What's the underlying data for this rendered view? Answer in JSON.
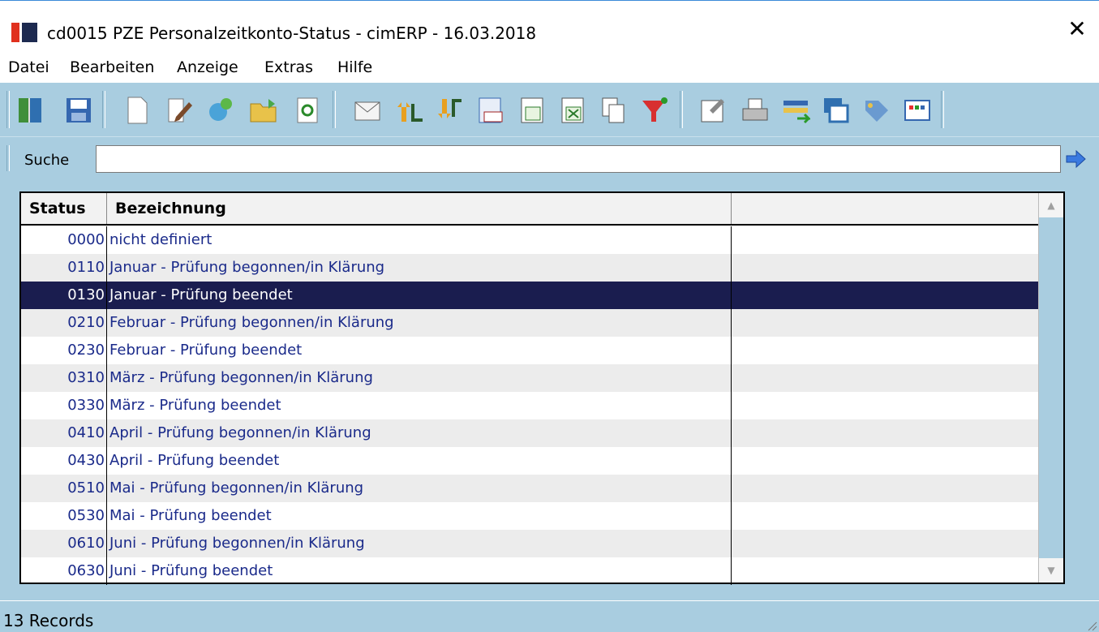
{
  "window": {
    "title": "cd0015 PZE Personalzeitkonto-Status - cimERP - 16.03.2018",
    "close_label": "✕"
  },
  "menu": [
    "Datei",
    "Bearbeiten",
    "Anzeige",
    "Extras",
    "Hilfe"
  ],
  "toolbar": {
    "buttons": [
      "exit-icon",
      "save-icon",
      "new-document-icon",
      "edit-icon",
      "copy-record-icon",
      "open-folder-icon",
      "refresh-icon",
      "mail-icon",
      "sort-ascending-icon",
      "sort-descending-icon",
      "number-format-icon",
      "export-icon",
      "excel-icon",
      "copy-icon",
      "filter-icon",
      "properties-icon",
      "print-icon",
      "transfer-icon",
      "windows-icon",
      "tag-icon",
      "grid-layout-icon"
    ]
  },
  "search": {
    "label": "Suche",
    "value": "",
    "go_icon": "arrow-right-icon"
  },
  "table": {
    "columns": [
      "Status",
      "Bezeichnung",
      ""
    ],
    "selected_index": 2,
    "rows": [
      {
        "status": "0000",
        "desc": "nicht definiert"
      },
      {
        "status": "0110",
        "desc": "Januar - Prüfung begonnen/in Klärung"
      },
      {
        "status": "0130",
        "desc": "Januar - Prüfung beendet"
      },
      {
        "status": "0210",
        "desc": "Februar - Prüfung begonnen/in Klärung"
      },
      {
        "status": "0230",
        "desc": "Februar - Prüfung beendet"
      },
      {
        "status": "0310",
        "desc": "März - Prüfung begonnen/in Klärung"
      },
      {
        "status": "0330",
        "desc": "März - Prüfung beendet"
      },
      {
        "status": "0410",
        "desc": "April - Prüfung begonnen/in Klärung"
      },
      {
        "status": "0430",
        "desc": "April - Prüfung beendet"
      },
      {
        "status": "0510",
        "desc": "Mai - Prüfung begonnen/in Klärung"
      },
      {
        "status": "0530",
        "desc": "Mai - Prüfung beendet"
      },
      {
        "status": "0610",
        "desc": "Juni - Prüfung begonnen/in Klärung"
      },
      {
        "status": "0630",
        "desc": "Juni - Prüfung beendet"
      }
    ]
  },
  "statusbar": {
    "text": "13 Records"
  },
  "colors": {
    "toolbar_bg": "#a9cde0",
    "selection_bg": "#1a1d4f",
    "row_text": "#1a2a8a",
    "alt_row_bg": "#ececec"
  }
}
